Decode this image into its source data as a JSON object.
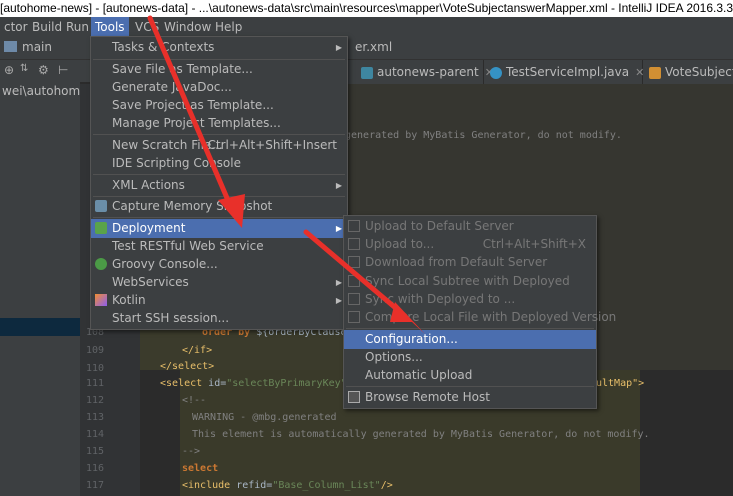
{
  "window": {
    "title": "[autohome-news] - [autonews-data] - ...\\autonews-data\\src\\main\\resources\\mapper\\VoteSubjectanswerMapper.xml - IntelliJ IDEA 2016.3.3"
  },
  "menubar": [
    {
      "label": "ctor"
    },
    {
      "label": "Build"
    },
    {
      "label": "Run"
    },
    {
      "label": "Tools"
    },
    {
      "label": "VCS"
    },
    {
      "label": "Window"
    },
    {
      "label": "Help"
    }
  ],
  "navbar": {
    "crumb_main": "main",
    "crumb_file": "er.xml"
  },
  "project": {
    "path": "wei\\autohome-news"
  },
  "tabs": [
    {
      "label": "autonews-parent",
      "icon": "maven-icon"
    },
    {
      "label": "TestServiceImpl.java",
      "icon": "class-icon"
    },
    {
      "label": "VoteSubjectan",
      "icon": "xml-icon"
    }
  ],
  "tools_menu": [
    {
      "label": "Tasks & Contexts",
      "arrow": "▶"
    },
    {
      "label": "Save File as Template..."
    },
    {
      "label": "Generate JavaDoc..."
    },
    {
      "label": "Save Project as Template..."
    },
    {
      "label": "Manage Project Templates..."
    },
    {
      "label": "New Scratch File...",
      "shortcut": "Ctrl+Alt+Shift+Insert"
    },
    {
      "label": "IDE Scripting Console"
    },
    {
      "label": "XML Actions",
      "arrow": "▶"
    },
    {
      "label": "Capture Memory Snapshot",
      "icon": "memory-icon"
    },
    {
      "label": "Deployment",
      "arrow": "▶",
      "icon": "deployment-icon"
    },
    {
      "label": "Test RESTful Web Service"
    },
    {
      "label": "Groovy Console...",
      "icon": "groovy-icon"
    },
    {
      "label": "WebServices",
      "arrow": "▶"
    },
    {
      "label": "Kotlin",
      "arrow": "▶",
      "icon": "kotlin-icon"
    },
    {
      "label": "Start SSH session..."
    }
  ],
  "deploy_menu": [
    {
      "label": "Upload to Default Server"
    },
    {
      "label": "Upload to...",
      "shortcut": "Ctrl+Alt+Shift+X"
    },
    {
      "label": "Download from Default Server"
    },
    {
      "label": "Sync Local Subtree with Deployed"
    },
    {
      "label": "Sync with Deployed to ..."
    },
    {
      "label": "Compare Local File with Deployed Version"
    },
    {
      "label": "Configuration..."
    },
    {
      "label": "Options..."
    },
    {
      "label": "Automatic Upload"
    },
    {
      "label": "Browse Remote Host"
    }
  ],
  "editor": {
    "line_numbers": [
      "108",
      "109",
      "110",
      "111",
      "112",
      "113",
      "114",
      "115",
      "116",
      "117"
    ],
    "hidden_comment": "generated by MyBatis Generator, do not modify.",
    "lines": [
      {
        "kw": "order by ",
        "rest": "${orderByClause}"
      },
      {
        "tag": "</if>"
      },
      {
        "tag": "</select>"
      },
      {
        "pre": "<select ",
        "attr": "id=",
        "str": "\"selectByPrimaryKey\"",
        "post": " par",
        "tail": "ultMap\">"
      },
      {
        "cmt": "<!--"
      },
      {
        "cmt": "WARNING - @mbg.generated"
      },
      {
        "cmt": "This element is automatically generated by MyBatis Generator, do not modify."
      },
      {
        "cmt": "-->"
      },
      {
        "kw": "select"
      },
      {
        "pre": "<include ",
        "attr": "refid=",
        "str": "\"Base_Column_List\"",
        "post": "/>"
      }
    ]
  }
}
